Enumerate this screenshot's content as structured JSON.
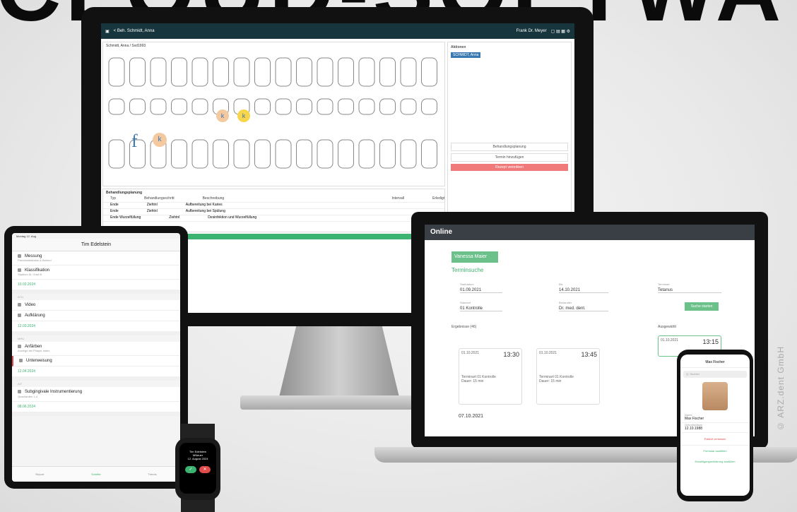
{
  "brand_text": "CLOUD-SOFTWA",
  "monitor": {
    "window_title": "< Beh. Schmidt, Anna",
    "user": "Frank Dr. Meyer",
    "patient_header": "Schmidt, Anna / Svd1993",
    "treatment_plan_title": "Behandlungsplanung",
    "table": {
      "headers": [
        "Typ",
        "Behandlungsschritt",
        "Beschreibung",
        "Intervall",
        "Erledigt"
      ],
      "rows": [
        [
          "Ende",
          "Ziehtnl",
          "Aufbereitung bei Karies"
        ],
        [
          "Ende",
          "Ziehtnl",
          "Aufbereitung bei Spülung"
        ],
        [
          "Ende Wurzelfüllung",
          "Ziehtnl",
          "Desinfektion und Wurzelfüllung"
        ]
      ]
    },
    "side": {
      "title": "Aktionen",
      "patient_name": "SCHMIDT, Anna",
      "buttons": [
        "Behandlungsplanung",
        "Termin hinzufügen",
        "Rezept verordnen"
      ]
    },
    "letters": [
      "f",
      "k",
      "k",
      "k"
    ]
  },
  "laptop": {
    "brand": "Online",
    "patient_chip": "Vanessa Maier",
    "title": "Terminsuche",
    "from_label": "Startdatum",
    "from_value": "01.09.2021",
    "to_label": "Bis",
    "to_value": "14.10.2021",
    "type_label": "Terminart",
    "type_value": "Tetanus",
    "location_label": "Standort",
    "location_value": "01 Kontrolle",
    "doctor_label": "Behandler",
    "doctor_value": "Dr. med. dent.",
    "search_button": "Suche starten",
    "results_label": "Ergebnisse (46)",
    "selected_label": "Ausgewählt",
    "slots": [
      {
        "date": "01.10.2021",
        "time": "13:30",
        "desc": "Terminart 01 Kontrolle",
        "dur": "Dauer: 15 min"
      },
      {
        "date": "01.10.2021",
        "time": "13:45",
        "desc": "Terminart 01 Kontrolle",
        "dur": "Dauer: 15 min"
      }
    ],
    "selected_slot": {
      "date": "01.10.2021",
      "time": "13:15"
    },
    "next_date": "07.10.2021"
  },
  "tablet": {
    "status": "Montag 12. Aug",
    "title": "Tim Edelstein",
    "sections": [
      {
        "title": "Messung",
        "sub": "Parodontalstatus & Befund",
        "date": ""
      },
      {
        "title": "Klassifikation",
        "sub": "Stadium III, Grad B",
        "date": "10.02.2024"
      },
      {
        "title": "Video",
        "sub": "",
        "date": ""
      },
      {
        "title": "Aufklärung",
        "sub": "",
        "date": "12.03.2024"
      },
      {
        "title": "Anfärben",
        "sub": "Anzeige bei Plaque Index",
        "date": ""
      },
      {
        "title": "Unterweisung",
        "sub": "",
        "date": "12.04.2024"
      },
      {
        "title": "Subgingivale Instrumentierung",
        "sub": "Quadranten 1-4",
        "date": "08.06.2024"
      }
    ],
    "group_labels": [
      "ATG",
      "MHU",
      "AIT"
    ],
    "footer": [
      "Report",
      "Schritte",
      "Trends"
    ]
  },
  "watch": {
    "line1": "Tim Edelstein",
    "line2": "MNeuer",
    "line3": "12. August 2024",
    "ok": "✓",
    "cancel": "✕"
  },
  "phone": {
    "header": "Max Fischer",
    "search": "Q. Suchen",
    "name_label": "Name",
    "name_value": "Max Fischer",
    "dob_label": "Geburtsdatum",
    "dob_value": "12.10.1988",
    "action1": "Patient verlassen",
    "action2": "Formular ausfüllen",
    "action3": "Einwilligungserklärung ausfüllen"
  },
  "copyright": "© ARZ.dent GmbH"
}
